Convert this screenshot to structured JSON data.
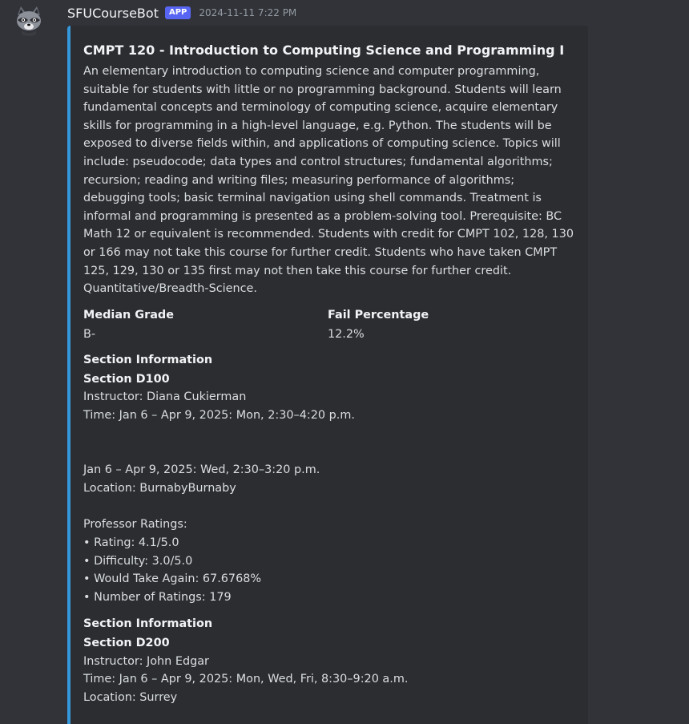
{
  "message": {
    "username": "SFUCourseBot",
    "badge": "APP",
    "timestamp": "2024-11-11 7:22 PM",
    "avatar_icon": "raccoon-avatar"
  },
  "embed": {
    "accent_color": "#3498db",
    "title": "CMPT 120 - Introduction to Computing Science and Programming I",
    "description": "An elementary introduction to computing science and computer programming, suitable for students with little or no programming background. Students will learn fundamental concepts and terminology of computing science, acquire elementary skills for programming in a high-level language, e.g. Python. The students will be exposed to diverse fields within, and applications of computing science. Topics will include: pseudocode; data types and control structures; fundamental algorithms; recursion; reading and writing files; measuring performance of algorithms; debugging tools; basic terminal navigation using shell commands. Treatment is informal and programming is presented as a problem-solving tool. Prerequisite: BC Math 12 or equivalent is recommended. Students with credit for CMPT 102, 128, 130 or 166 may not take this course for further credit. Students who have taken CMPT 125, 129, 130 or 135 first may not then take this course for further credit. Quantitative/Breadth-Science.",
    "fields": [
      {
        "name": "Median Grade",
        "value": "B-"
      },
      {
        "name": "Fail Percentage",
        "value": "12.2%"
      }
    ],
    "sections": [
      {
        "name": "Section Information",
        "section": "Section D100",
        "body": "Instructor: Diana Cukierman\nTime: Jan 6 – Apr 9, 2025: Mon, 2:30–4:20 p.m.\n\n\nJan 6 – Apr 9, 2025: Wed, 2:30–3:20 p.m.\nLocation: BurnabyBurnaby\n\nProfessor Ratings:\n• Rating: 4.1/5.0\n• Difficulty: 3.0/5.0\n• Would Take Again: 67.6768%\n• Number of Ratings: 179"
      },
      {
        "name": "Section Information",
        "section": "Section D200",
        "body": "Instructor: John Edgar\nTime: Jan 6 – Apr 9, 2025: Mon, Wed, Fri, 8:30–9:20 a.m.\nLocation: Surrey"
      }
    ]
  }
}
